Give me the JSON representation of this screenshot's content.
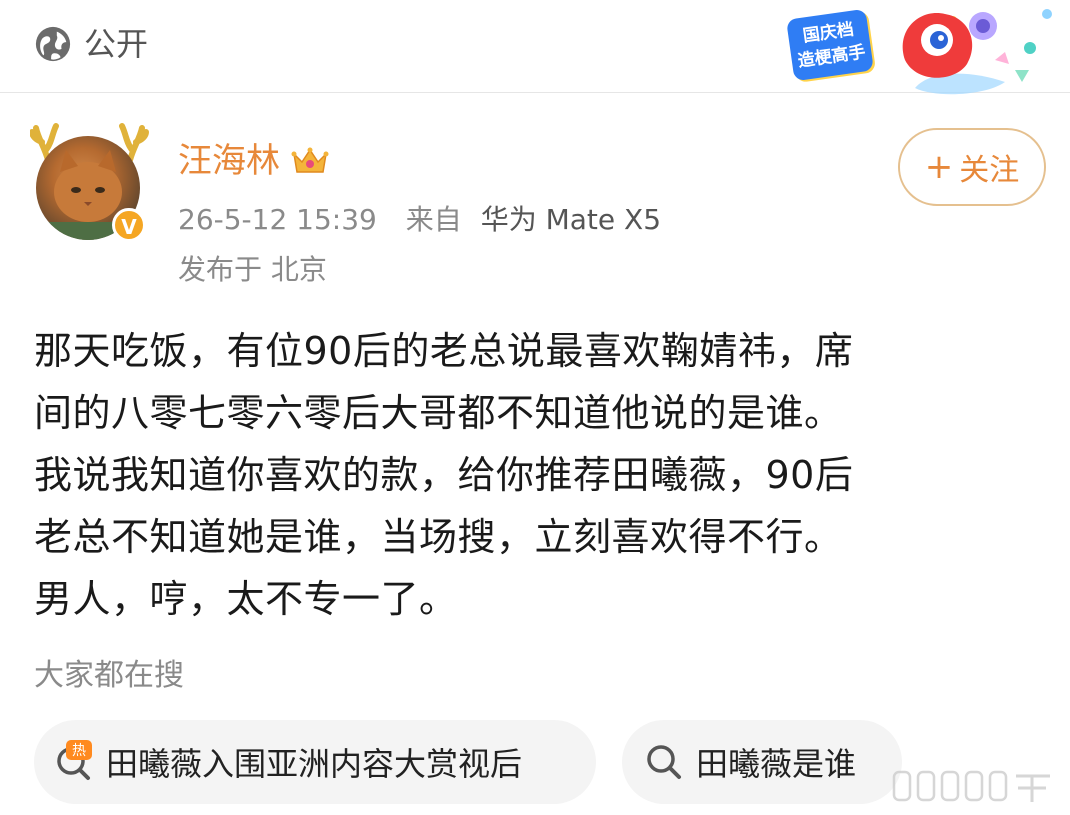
{
  "topbar": {
    "privacy_label": "公开",
    "promo_line1": "国庆档",
    "promo_line2": "造梗高手"
  },
  "post": {
    "username": "汪海林",
    "timestamp": "26-5-12 15:39",
    "source_prefix": "来自",
    "device": "华为 Mate X5",
    "location": "发布于 北京",
    "follow_label": "关注",
    "follow_plus": "+",
    "verify_mark": "V",
    "text": "那天吃饭，有位90后的老总说最喜欢鞠婧祎，席\n间的八零七零六零后大哥都不知道他说的是谁。\n我说我知道你喜欢的款，给你推荐田曦薇，90后\n老总不知道她是谁，当场搜，立刻喜欢得不行。\n男人，哼，太不专一了。"
  },
  "hot_search": {
    "title": "大家都在搜",
    "items": [
      {
        "label": "田曦薇入围亚洲内容大赏视后",
        "icon": "hot-search-icon",
        "hot_mark": "热"
      },
      {
        "label": "田曦薇是谁",
        "icon": "search-icon"
      }
    ]
  },
  "colors": {
    "accent": "#e7883a",
    "follow_border": "#e5c08f",
    "muted": "#8a8a8a",
    "chip_bg": "#f4f4f4",
    "verify": "#f5a623"
  }
}
